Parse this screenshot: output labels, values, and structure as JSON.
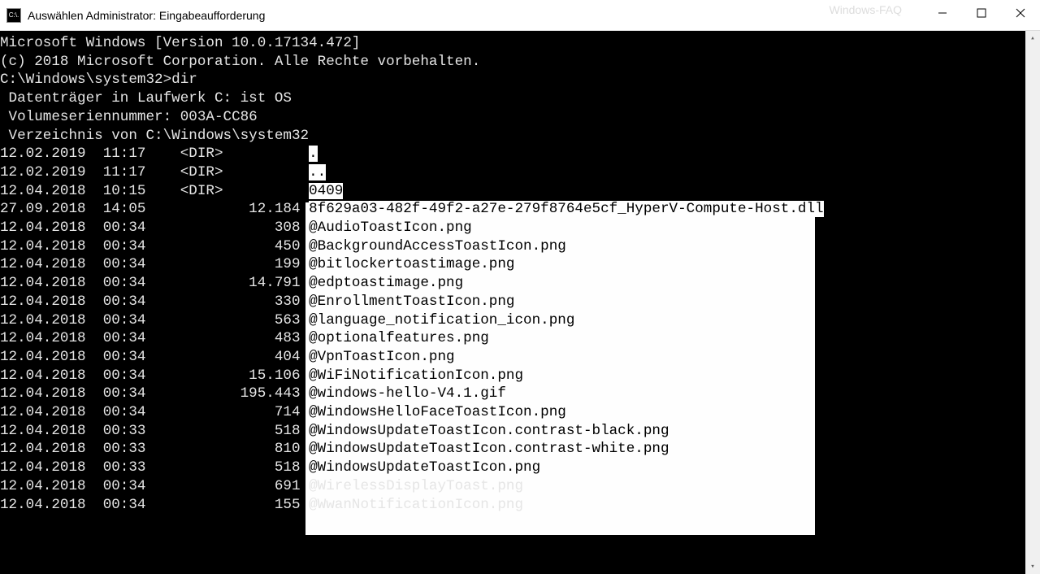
{
  "titlebar": {
    "icon_text": "C:\\.",
    "title": "Auswählen Administrator: Eingabeaufforderung",
    "watermark": "Windows-FAQ"
  },
  "header": {
    "line1": "Microsoft Windows [Version 10.0.17134.472]",
    "line2": "(c) 2018 Microsoft Corporation. Alle Rechte vorbehalten."
  },
  "prompt": {
    "path": "C:\\Windows\\system32>",
    "cmd": "dir"
  },
  "dir_header": {
    "volume": " Datenträger in Laufwerk C: ist OS",
    "serial": " Volumeseriennummer: 003A-CC86",
    "directory": " Verzeichnis von C:\\Windows\\system32"
  },
  "rows": [
    {
      "date": "12.02.2019",
      "time": "11:17",
      "dir": "<DIR>",
      "size": "",
      "name": ".",
      "sel": true
    },
    {
      "date": "12.02.2019",
      "time": "11:17",
      "dir": "<DIR>",
      "size": "",
      "name": "..",
      "sel": true
    },
    {
      "date": "12.04.2018",
      "time": "10:15",
      "dir": "<DIR>",
      "size": "",
      "name": "0409",
      "sel": true
    },
    {
      "date": "27.09.2018",
      "time": "14:05",
      "dir": "",
      "size": "12.184",
      "name": "8f629a03-482f-49f2-a27e-279f8764e5cf_HyperV-Compute-Host.dll",
      "sel": true
    },
    {
      "date": "12.04.2018",
      "time": "00:34",
      "dir": "",
      "size": "308",
      "name": "@AudioToastIcon.png",
      "sel": true
    },
    {
      "date": "12.04.2018",
      "time": "00:34",
      "dir": "",
      "size": "450",
      "name": "@BackgroundAccessToastIcon.png",
      "sel": true
    },
    {
      "date": "12.04.2018",
      "time": "00:34",
      "dir": "",
      "size": "199",
      "name": "@bitlockertoastimage.png",
      "sel": true
    },
    {
      "date": "12.04.2018",
      "time": "00:34",
      "dir": "",
      "size": "14.791",
      "name": "@edptoastimage.png",
      "sel": true
    },
    {
      "date": "12.04.2018",
      "time": "00:34",
      "dir": "",
      "size": "330",
      "name": "@EnrollmentToastIcon.png",
      "sel": true
    },
    {
      "date": "12.04.2018",
      "time": "00:34",
      "dir": "",
      "size": "563",
      "name": "@language_notification_icon.png",
      "sel": true
    },
    {
      "date": "12.04.2018",
      "time": "00:34",
      "dir": "",
      "size": "483",
      "name": "@optionalfeatures.png",
      "sel": true
    },
    {
      "date": "12.04.2018",
      "time": "00:34",
      "dir": "",
      "size": "404",
      "name": "@VpnToastIcon.png",
      "sel": true
    },
    {
      "date": "12.04.2018",
      "time": "00:34",
      "dir": "",
      "size": "15.106",
      "name": "@WiFiNotificationIcon.png",
      "sel": true
    },
    {
      "date": "12.04.2018",
      "time": "00:34",
      "dir": "",
      "size": "195.443",
      "name": "@windows-hello-V4.1.gif",
      "sel": true
    },
    {
      "date": "12.04.2018",
      "time": "00:34",
      "dir": "",
      "size": "714",
      "name": "@WindowsHelloFaceToastIcon.png",
      "sel": true
    },
    {
      "date": "12.04.2018",
      "time": "00:33",
      "dir": "",
      "size": "518",
      "name": "@WindowsUpdateToastIcon.contrast-black.png",
      "sel": true
    },
    {
      "date": "12.04.2018",
      "time": "00:33",
      "dir": "",
      "size": "810",
      "name": "@WindowsUpdateToastIcon.contrast-white.png",
      "sel": true
    },
    {
      "date": "12.04.2018",
      "time": "00:33",
      "dir": "",
      "size": "518",
      "name": "@WindowsUpdateToastIcon.png",
      "sel": true
    },
    {
      "date": "12.04.2018",
      "time": "00:34",
      "dir": "",
      "size": "691",
      "name": "@WirelessDisplayToast.png",
      "sel": false
    },
    {
      "date": "12.04.2018",
      "time": "00:34",
      "dir": "",
      "size": "155",
      "name": "@WwanNotificationIcon.png",
      "sel": false
    }
  ]
}
